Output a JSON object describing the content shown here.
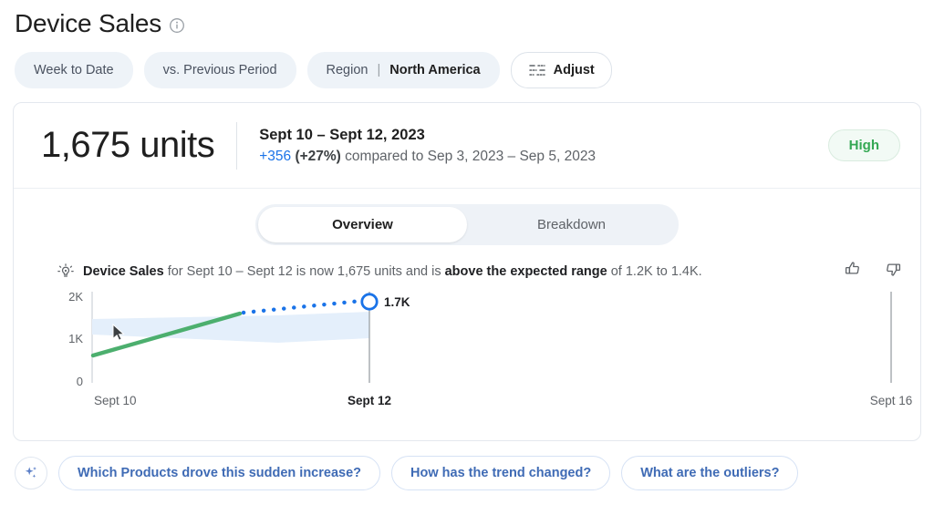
{
  "header": {
    "title": "Device Sales",
    "info_icon": "info-circle-icon"
  },
  "filters": {
    "timeframe": "Week to Date",
    "comparison": "vs. Previous Period",
    "region_label": "Region",
    "region_separator": "|",
    "region_value": "North America",
    "adjust_label": "Adjust",
    "adjust_icon": "tune-sliders-icon"
  },
  "summary": {
    "value": "1,675 units",
    "date_range": "Sept 10 – Sept 12, 2023",
    "delta_value": "+356",
    "delta_percent": "(+27%)",
    "comparison_text": "compared to Sep 3, 2023 – Sep 5, 2023",
    "status": "High",
    "status_color": "#34a853"
  },
  "tabs": [
    {
      "label": "Overview",
      "active": true
    },
    {
      "label": "Breakdown",
      "active": false
    }
  ],
  "insight": {
    "icon": "lightbulb-insight-icon",
    "metric": "Device Sales",
    "part1": " for Sept 10 – Sept 12 is now 1,675 units and is ",
    "emphasis": "above the expected range",
    "part2": " of 1.2K to 1.4K.",
    "thumbs_up_icon": "thumbs-up-icon",
    "thumbs_down_icon": "thumbs-down-icon"
  },
  "chart_data": {
    "type": "line",
    "title": "",
    "xlabel": "",
    "ylabel": "",
    "ylim": [
      0,
      2000
    ],
    "ytick_labels": [
      "2K",
      "1K",
      "0"
    ],
    "ytick_values": [
      2000,
      1000,
      0
    ],
    "xtick_labels": [
      "Sept 10",
      "Sept 12",
      "Sept 16"
    ],
    "xtick_values": [
      "2023-09-10",
      "2023-09-12",
      "2023-09-16"
    ],
    "grid": false,
    "legend": "none",
    "series": [
      {
        "name": "Actual",
        "style": "solid",
        "color": "#4CAF6E",
        "x": [
          "Sept 10",
          "Sept 11"
        ],
        "values": [
          500,
          1500
        ]
      },
      {
        "name": "Projected",
        "style": "dotted",
        "color": "#1a73e8",
        "x": [
          "Sept 11",
          "Sept 12"
        ],
        "values": [
          1500,
          1675
        ]
      }
    ],
    "band": {
      "name": "Expected range",
      "color": "#e3effb",
      "lower": [
        950,
        900,
        950
      ],
      "upper": [
        1400,
        1350,
        1430
      ]
    },
    "marker": {
      "label": "1.7K",
      "value": 1675,
      "x": "Sept 12",
      "color": "#1a73e8"
    },
    "annotations": [
      "Sept 12 reference line",
      "Sept 16 reference line"
    ],
    "cursor": {
      "type": "mouse-pointer",
      "x": 122,
      "y": 384
    }
  },
  "suggestions": {
    "sparkle_icon": "sparkle-ai-icon",
    "chips": [
      "Which Products drove this sudden increase?",
      "How has the trend changed?",
      "What are the outliers?"
    ]
  }
}
